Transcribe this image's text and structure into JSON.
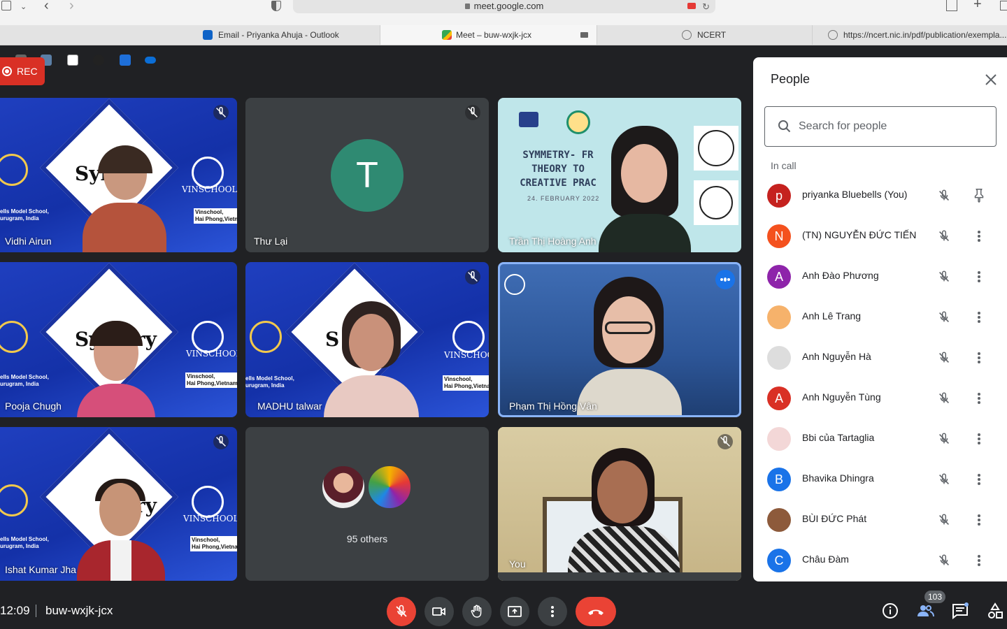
{
  "browser": {
    "url": "meet.google.com",
    "tabs": [
      {
        "label": "Email - Priyanka Ahuja - Outlook"
      },
      {
        "label": "Meet – buw-wxjk-jcx"
      },
      {
        "label": "NCERT"
      },
      {
        "label": "https://ncert.nic.in/pdf/publication/exempla..."
      }
    ]
  },
  "meet": {
    "rec_label": "REC",
    "time": "12:09",
    "meeting_code": "buw-wxjk-jcx",
    "participant_count": "103",
    "tiles": [
      {
        "name": "Vidhi Airun",
        "muted": true
      },
      {
        "name": "Thư Lại",
        "muted": true,
        "initial": "T"
      },
      {
        "name": "Trần Thị Hoàng Anh",
        "muted": false
      },
      {
        "name": "Pooja Chugh",
        "muted": false
      },
      {
        "name": "MADHU talwar",
        "muted": true
      },
      {
        "name": "Phạm Thị Hồng Vân",
        "muted": false,
        "speaking": true
      },
      {
        "name": "Ishat Kumar Jha",
        "muted": true
      },
      {
        "name": "95 others"
      },
      {
        "name": "You",
        "muted": true
      }
    ],
    "slide": {
      "title_line1": "SYMMETRY- FR",
      "title_line2": "THEORY TO",
      "title_line3": "CREATIVE PRAC",
      "date": "24. FEBRUARY 2022"
    },
    "backdrop": {
      "word1": "Syn",
      "word2": "Sy",
      "word3": "try",
      "word4": "S",
      "vinschool": "VINSCHOOL",
      "bluebells": "ells Model School,\nurugram, India",
      "vin_addr": "Vinschool,\nHai Phong,Vietnam"
    }
  },
  "people_panel": {
    "title": "People",
    "search_placeholder": "Search for people",
    "section_label": "In call",
    "people": [
      {
        "name": "priyanka Bluebells (You)",
        "initial": "p",
        "color": "#c5221f"
      },
      {
        "name": "(TN) NGUYỄN ĐỨC TIẾN",
        "initial": "N",
        "color": "#f4511e"
      },
      {
        "name": "Anh Đào Phương",
        "initial": "A",
        "color": "#8e24aa"
      },
      {
        "name": "Anh Lê Trang",
        "initial": "",
        "color": "#f6b26b"
      },
      {
        "name": "Anh Nguyễn Hà",
        "initial": "",
        "color": "#dddddd"
      },
      {
        "name": "Anh Nguyễn Tùng",
        "initial": "A",
        "color": "#d93025"
      },
      {
        "name": "Bbi của Tartaglia",
        "initial": "",
        "color": "#f3d7d7"
      },
      {
        "name": "Bhavika Dhingra",
        "initial": "B",
        "color": "#1a73e8"
      },
      {
        "name": "BÙI ĐỨC Phát",
        "initial": "",
        "color": "#8d5a3b"
      },
      {
        "name": "Châu Đàm",
        "initial": "C",
        "color": "#1a73e8"
      }
    ]
  }
}
